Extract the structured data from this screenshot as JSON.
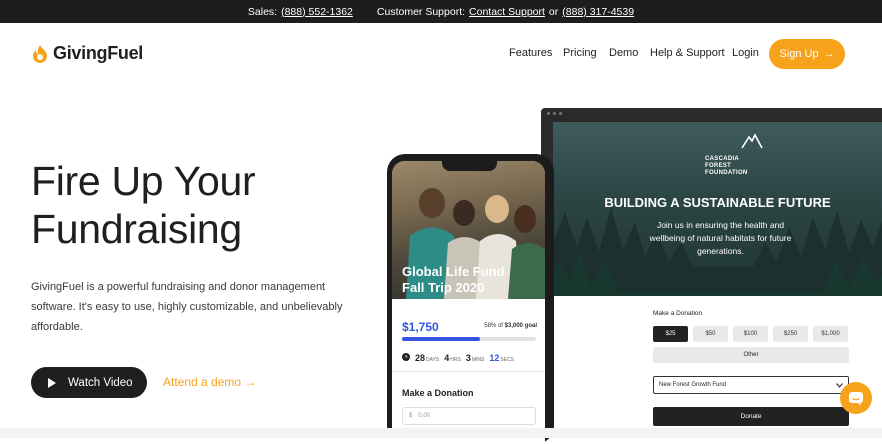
{
  "topbar": {
    "sales_label": "Sales:",
    "sales_phone": "(888) 552-1362",
    "support_label": "Customer Support:",
    "support_link": "Contact Support",
    "or": "or",
    "support_phone": "(888) 317-4539"
  },
  "nav": {
    "brand": "GivingFuel",
    "items": [
      "Features",
      "Pricing",
      "Demo",
      "Help & Support",
      "Login"
    ],
    "signup": "Sign Up"
  },
  "hero": {
    "title": "Fire Up Your Fundraising",
    "lede": "GivingFuel is a powerful fundraising and donor management software. It's easy to use, highly customizable, and unbelievably affordable.",
    "watch_video": "Watch Video",
    "attend_demo": "Attend a demo"
  },
  "desktop_mock": {
    "org_name": "CASCADIA FOREST FOUNDATION",
    "headline": "BUILDING A SUSTAINABLE FUTURE",
    "subtext": "Join us in ensuring the health and wellbeing of natural habitats for future generations.",
    "make_donation": "Make a Donation",
    "amounts": [
      "$25",
      "$50",
      "$100",
      "$250",
      "$1,000"
    ],
    "selected_amount": "$25",
    "other": "Other",
    "fund": "New Forest Growth Fund",
    "donate": "Donate"
  },
  "phone_mock": {
    "campaign": "Global Life Fund Fall Trip 2020",
    "raised": "$1,750",
    "percent_text": "58% of",
    "goal": "$3,000 goal",
    "progress": 0.58,
    "countdown": [
      {
        "value": "28",
        "unit": "DAYS"
      },
      {
        "value": "4",
        "unit": "HRS"
      },
      {
        "value": "3",
        "unit": "MINS"
      },
      {
        "value": "12",
        "unit": "SECS"
      }
    ],
    "make_donation": "Make a Donation",
    "amount_placeholder": "0.00",
    "currency": "$"
  },
  "colors": {
    "accent": "#f7a21b",
    "blue": "#3355e0",
    "dark": "#1f1f1f"
  }
}
